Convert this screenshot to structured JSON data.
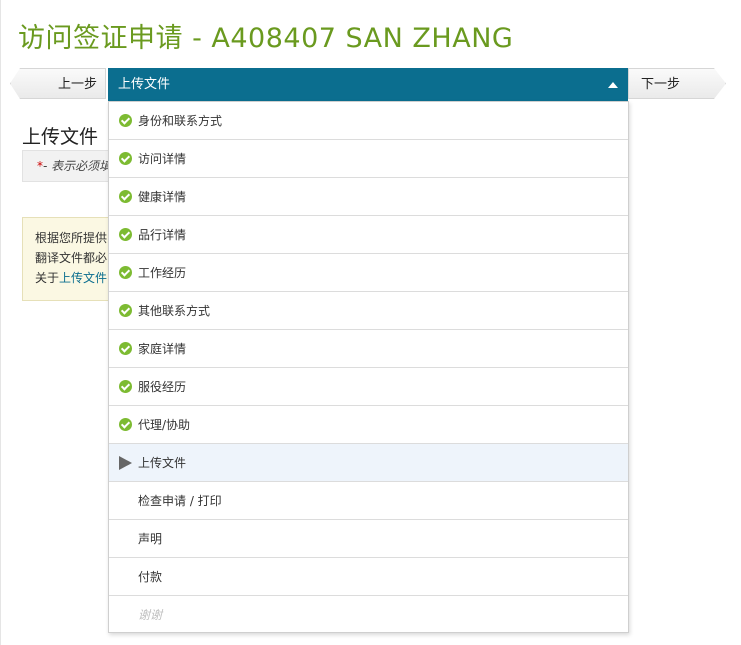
{
  "page": {
    "title": "访问签证申请 - A408407 SAN ZHANG"
  },
  "nav": {
    "prev_label": "上一步",
    "next_label": "下一步",
    "current_step": "上传文件"
  },
  "background": {
    "section_title": "上传文件",
    "required_star": "*",
    "required_note": "- 表示必须填",
    "info_line1": "根据您所提供",
    "info_line2": "翻译文件都必",
    "info_line3_prefix": "关于",
    "info_link": "上传文件"
  },
  "steps": [
    {
      "label": "身份和联系方式",
      "status": "done"
    },
    {
      "label": "访问详情",
      "status": "done"
    },
    {
      "label": "健康详情",
      "status": "done"
    },
    {
      "label": "品行详情",
      "status": "done"
    },
    {
      "label": "工作经历",
      "status": "done"
    },
    {
      "label": "其他联系方式",
      "status": "done"
    },
    {
      "label": "家庭详情",
      "status": "done"
    },
    {
      "label": "服役经历",
      "status": "done"
    },
    {
      "label": "代理/协助",
      "status": "done"
    },
    {
      "label": "上传文件",
      "status": "current"
    },
    {
      "label": "检查申请 / 打印",
      "status": "pending"
    },
    {
      "label": "声明",
      "status": "pending"
    },
    {
      "label": "付款",
      "status": "pending"
    },
    {
      "label": "谢谢",
      "status": "disabled"
    }
  ],
  "colors": {
    "title": "#6a9a1f",
    "header": "#0b6e8f",
    "check": "#7dbb32"
  }
}
